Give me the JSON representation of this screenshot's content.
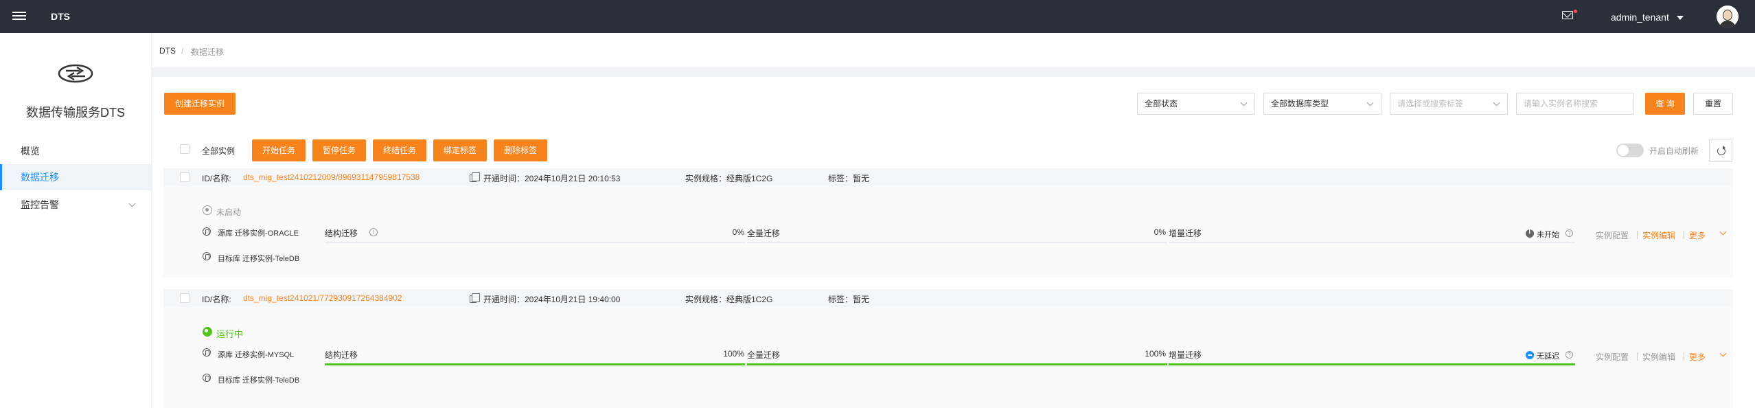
{
  "app": {
    "title": "DTS",
    "user": "admin_tenant"
  },
  "sidebar": {
    "service_title": "数据传输服务DTS",
    "items": [
      {
        "label": "概览"
      },
      {
        "label": "数据迁移"
      },
      {
        "label": "监控告警"
      }
    ]
  },
  "breadcrumb": {
    "root": "DTS",
    "separator": "/",
    "current": "数据迁移"
  },
  "toolbar": {
    "create_label": "创建迁移实例",
    "status_select": "全部状态",
    "dbtype_select": "全部数据库类型",
    "tag_placeholder": "请选择或搜索标签",
    "name_placeholder": "请输入实例名称搜索",
    "query_label": "查 询",
    "reset_label": "重置"
  },
  "actions": {
    "all_label": "全部实例",
    "start_label": "开始任务",
    "pause_label": "暂停任务",
    "stop_label": "终结任务",
    "bind_tag_label": "绑定标签",
    "delete_tag_label": "删除标签",
    "auto_refresh_label": "开启自动刷新"
  },
  "tasks": [
    {
      "id_label": "ID/名称:",
      "id": "dts_mig_test2410212009/896931147959817538",
      "open_time": "开通时间：2024年10月21日 20:10:53",
      "spec": "实例规格：经典版1C2G",
      "tags": "标签：暂无",
      "status": "未启动",
      "source": "源库 迁移实例-ORACLE",
      "target": "目标库 迁移实例-TeleDB",
      "structure_label": "结构迁移",
      "structure_pct": "0%",
      "structure_progress": 0,
      "full_label": "全量迁移",
      "full_pct": "0%",
      "full_progress": 0,
      "incr_label": "增量迁移",
      "incr_state": "未开始",
      "incr_progress": 0,
      "op_config": "实例配置",
      "op_edit": "实例编辑",
      "op_more": "更多"
    },
    {
      "id_label": "ID/名称:",
      "id": "dts_mig_test241021/772930917264384902",
      "open_time": "开通时间：2024年10月21日 19:40:00",
      "spec": "实例规格：经典版1C2G",
      "tags": "标签：暂无",
      "status": "运行中",
      "source": "源库 迁移实例-MYSQL",
      "target": "目标库 迁移实例-TeleDB",
      "structure_label": "结构迁移",
      "structure_pct": "100%",
      "structure_progress": 1,
      "full_label": "全量迁移",
      "full_pct": "100%",
      "full_progress": 1,
      "incr_label": "增量迁移",
      "incr_state": "无延迟",
      "incr_progress": 1,
      "op_config": "实例配置",
      "op_edit": "实例编辑",
      "op_more": "更多"
    }
  ],
  "colors": {
    "accent": "#f7831d",
    "running": "#52c41a",
    "link_blue": "#1890ff",
    "topbar": "#2b2f3a"
  },
  "icons": [
    "menu-icon",
    "mail-icon",
    "user-caret-icon",
    "dts-logo-icon",
    "chevron-down-icon",
    "refresh-icon",
    "copy-icon",
    "status-icon",
    "db-icon",
    "info-icon",
    "help-icon"
  ]
}
